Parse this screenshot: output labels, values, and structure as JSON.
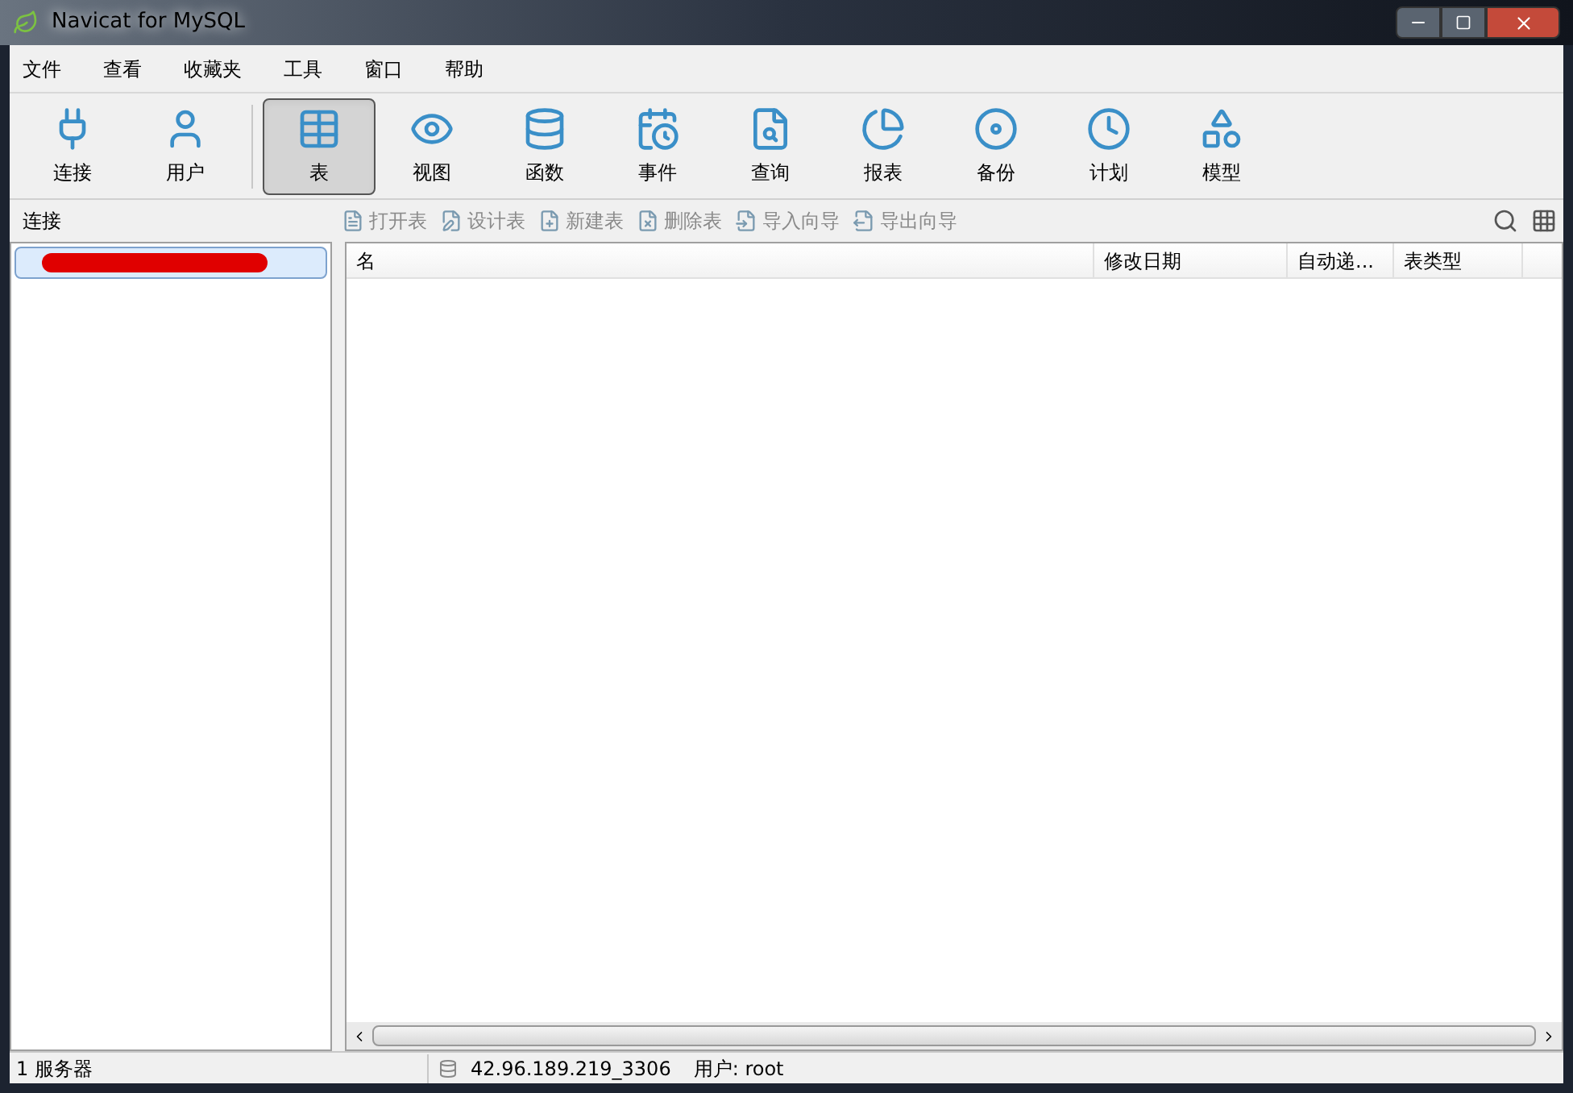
{
  "window": {
    "title": "Navicat for MySQL"
  },
  "menu": [
    "文件",
    "查看",
    "收藏夹",
    "工具",
    "窗口",
    "帮助"
  ],
  "toolbar": [
    {
      "kind": "plug",
      "label": "连接",
      "selected": false
    },
    {
      "kind": "user",
      "label": "用户",
      "selected": false
    },
    {
      "kind": "table",
      "label": "表",
      "selected": true
    },
    {
      "kind": "view",
      "label": "视图",
      "selected": false
    },
    {
      "kind": "function",
      "label": "函数",
      "selected": false
    },
    {
      "kind": "event",
      "label": "事件",
      "selected": false
    },
    {
      "kind": "query",
      "label": "查询",
      "selected": false
    },
    {
      "kind": "report",
      "label": "报表",
      "selected": false
    },
    {
      "kind": "backup",
      "label": "备份",
      "selected": false
    },
    {
      "kind": "schedule",
      "label": "计划",
      "selected": false
    },
    {
      "kind": "model",
      "label": "模型",
      "selected": false
    }
  ],
  "sidebar": {
    "title": "连接",
    "items": [
      {
        "selected": true,
        "redacted": true
      }
    ]
  },
  "actions": [
    {
      "label": "打开表",
      "disabled": true
    },
    {
      "label": "设计表",
      "disabled": true
    },
    {
      "label": "新建表",
      "disabled": true
    },
    {
      "label": "删除表",
      "disabled": true
    },
    {
      "label": "导入向导",
      "disabled": true
    },
    {
      "label": "导出向导",
      "disabled": true
    }
  ],
  "table": {
    "columns": [
      "名",
      "修改日期",
      "自动递...",
      "表类型"
    ]
  },
  "status_bar": {
    "left": "1 服务器",
    "connection": "42.96.189.219_3306",
    "user": "用户: root"
  }
}
